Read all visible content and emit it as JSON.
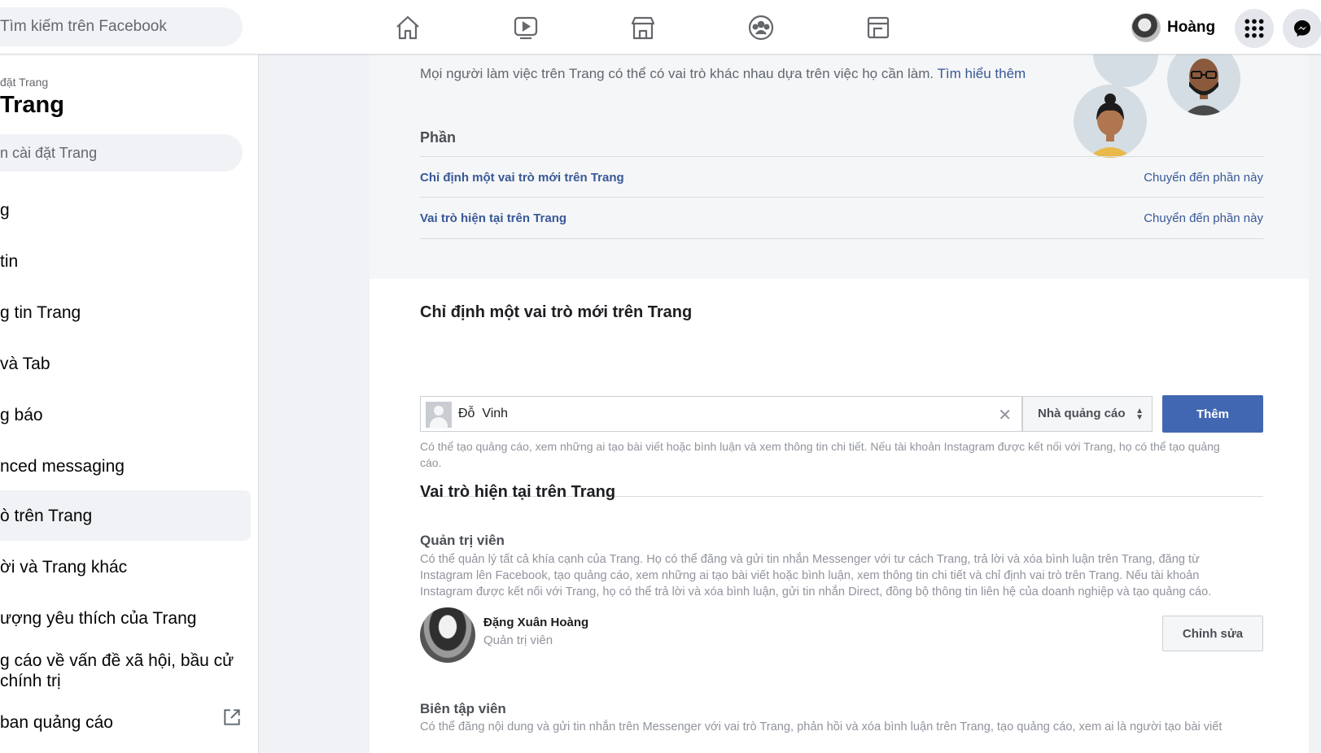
{
  "topbar": {
    "search_placeholder": "Tìm kiếm trên Facebook",
    "nav_icons": [
      "home-icon",
      "watch-icon",
      "marketplace-icon",
      "groups-icon",
      "gaming-icon"
    ],
    "user_name": "Hoàng",
    "menu_icon": "grid-menu-icon",
    "messenger_icon": "messenger-icon"
  },
  "sidebar": {
    "crumb": "đặt Trang",
    "title": "Trang",
    "search_placeholder": "n cài đặt Trang",
    "items": [
      {
        "label": "g"
      },
      {
        "label": " tin"
      },
      {
        "label": "g tin Trang"
      },
      {
        "label": "và Tab"
      },
      {
        "label": "g báo"
      },
      {
        "label": "nced messaging"
      },
      {
        "label": "ò trên Trang"
      },
      {
        "label": "ời và Trang khác"
      },
      {
        "label": "ượng yêu thích của Trang"
      },
      {
        "label": "g cáo về vấn đề xã hội, bầu cử",
        "label2": "chính trị"
      },
      {
        "label": "ban quảng cáo"
      }
    ],
    "active_index": 6
  },
  "top_panel": {
    "intro_text": "Mọi người làm việc trên Trang có thể có vai trò khác nhau dựa trên việc họ cần làm.",
    "intro_link": "Tìm hiểu thêm",
    "section_label": "Phần",
    "rows": [
      {
        "label": "Chỉ định một vai trò mới trên Trang",
        "action": "Chuyển đến phần này"
      },
      {
        "label": "Vai trò hiện tại trên Trang",
        "action": "Chuyển đến phần này"
      }
    ]
  },
  "assign": {
    "heading": "Chỉ định một vai trò mới trên Trang",
    "input_value": "Đỗ  Vinh",
    "clear_icon": "close-icon",
    "role_selected": "Nhà quảng cáo",
    "add_label": "Thêm",
    "help_text": "Có thể tạo quảng cáo, xem những ai tạo bài viết hoặc bình luận và xem thông tin chi tiết. Nếu tài khoản Instagram được kết nối với Trang, họ có thể tạo quảng cáo."
  },
  "current_roles": {
    "heading": "Vai trò hiện tại trên Trang",
    "admin": {
      "title": "Quản trị viên",
      "description": "Có thể quản lý tất cả khía cạnh của Trang. Họ có thể đăng và gửi tin nhắn Messenger với tư cách Trang, trả lời và xóa bình luận trên Trang, đăng từ Instagram lên Facebook, tạo quảng cáo, xem những ai tạo bài viết hoặc bình luận, xem thông tin chi tiết và chỉ định vai trò trên Trang. Nếu tài khoản Instagram được kết nối với Trang, họ có thể trả lời và xóa bình luận, gửi tin nhắn Direct, đồng bộ thông tin liên hệ của doanh nghiệp và tạo quảng cáo.",
      "member_name": "Đặng Xuân Hoàng",
      "member_role": "Quản trị viên",
      "edit_label": "Chỉnh sửa"
    },
    "editor": {
      "title": "Biên tập viên",
      "description": "Có thể đăng nội dung và gửi tin nhắn trên Messenger với vai trò Trang, phản hồi và xóa bình luận trên Trang, tạo quảng cáo, xem ai là người tạo bài viết"
    }
  },
  "colors": {
    "link": "#385898",
    "primary_button": "#4267b2",
    "page_bg": "#f0f2f5"
  }
}
